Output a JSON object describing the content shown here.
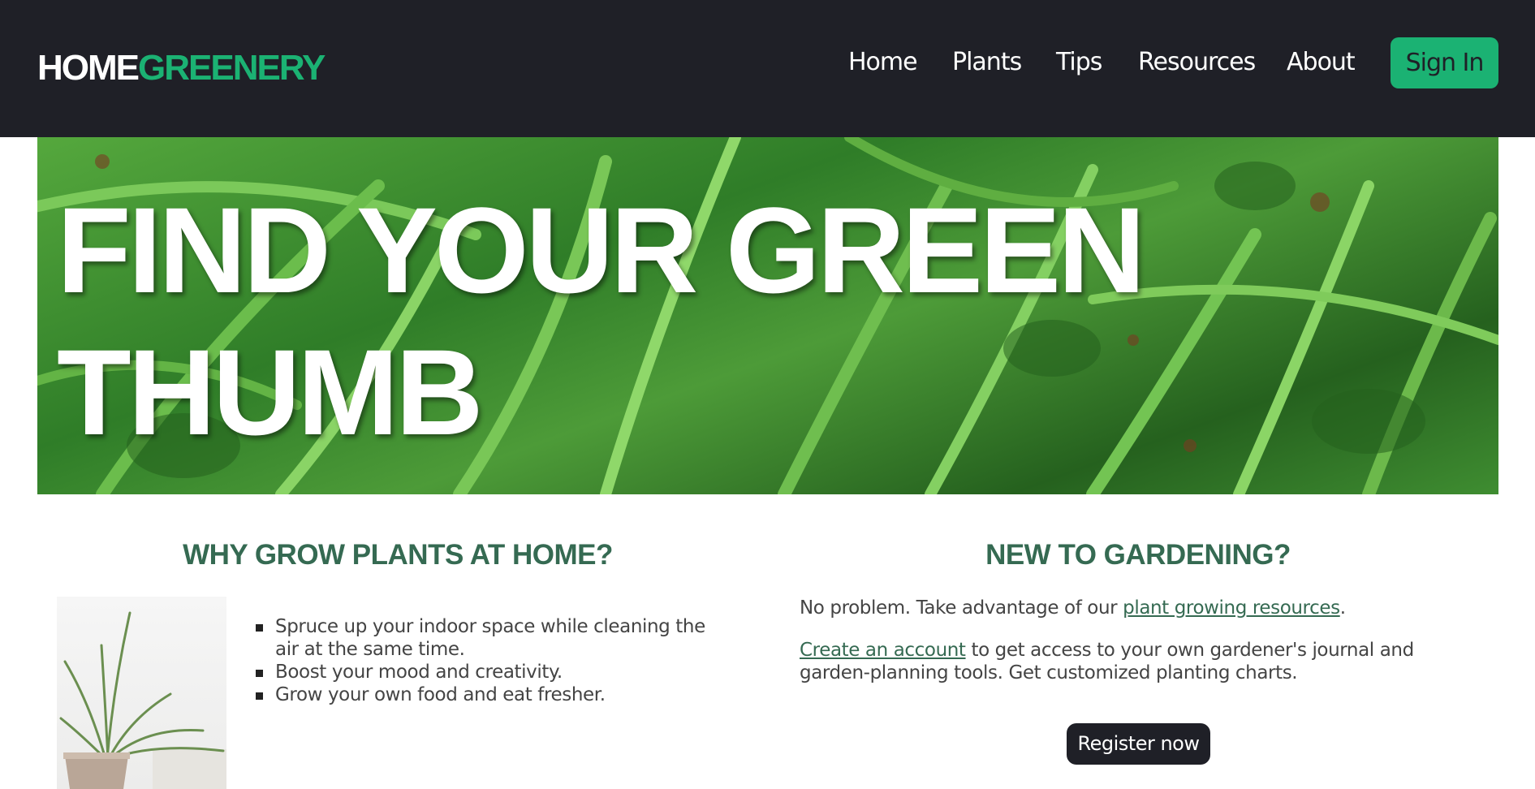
{
  "header": {
    "logo_part1": "HOME",
    "logo_part2": "GREENERY",
    "nav": [
      {
        "label": "Home"
      },
      {
        "label": "Plants"
      },
      {
        "label": "Tips"
      },
      {
        "label": "Resources"
      },
      {
        "label": "About"
      }
    ],
    "sign_in_label": "Sign In"
  },
  "hero": {
    "title_line1": "FIND YOUR GREEN",
    "title_line2": "THUMB"
  },
  "why": {
    "heading": "WHY GROW PLANTS AT HOME?",
    "items": [
      "Spruce up your indoor space while cleaning the air at the same time.",
      "Boost your mood and creativity.",
      "Grow your own food and eat fresher."
    ]
  },
  "new": {
    "heading": "NEW TO GARDENING?",
    "p1_pre": "No problem. Take advantage of our ",
    "p1_link": "plant growing resources",
    "p1_post": ".",
    "p2_link": "Create an account",
    "p2_post": " to get access to your own gardener's journal and garden-planning tools. Get customized planting charts.",
    "register_label": "Register now"
  },
  "colors": {
    "header_bg": "#1f2027",
    "accent": "#1bb273",
    "heading": "#356a52"
  }
}
